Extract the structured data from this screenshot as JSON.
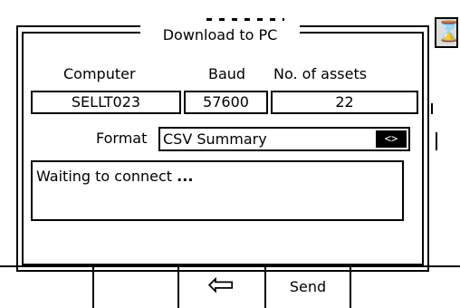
{
  "dialog": {
    "title": "Download to PC"
  },
  "fields": {
    "computer_label": "Computer",
    "computer_value": "SELLT023",
    "baud_label": "Baud",
    "baud_value": "57600",
    "assets_label": "No. of assets",
    "assets_value": "22"
  },
  "format": {
    "label": "Format",
    "value": "CSV Summary",
    "arrows": "<>"
  },
  "status": {
    "text": "Waiting to connect",
    "ellipsis": "..."
  },
  "icons": {
    "busy": "hourglass-icon",
    "back": "left-arrow-icon"
  },
  "softkeys": {
    "back_symbol": "⇦",
    "send_label": "Send"
  }
}
